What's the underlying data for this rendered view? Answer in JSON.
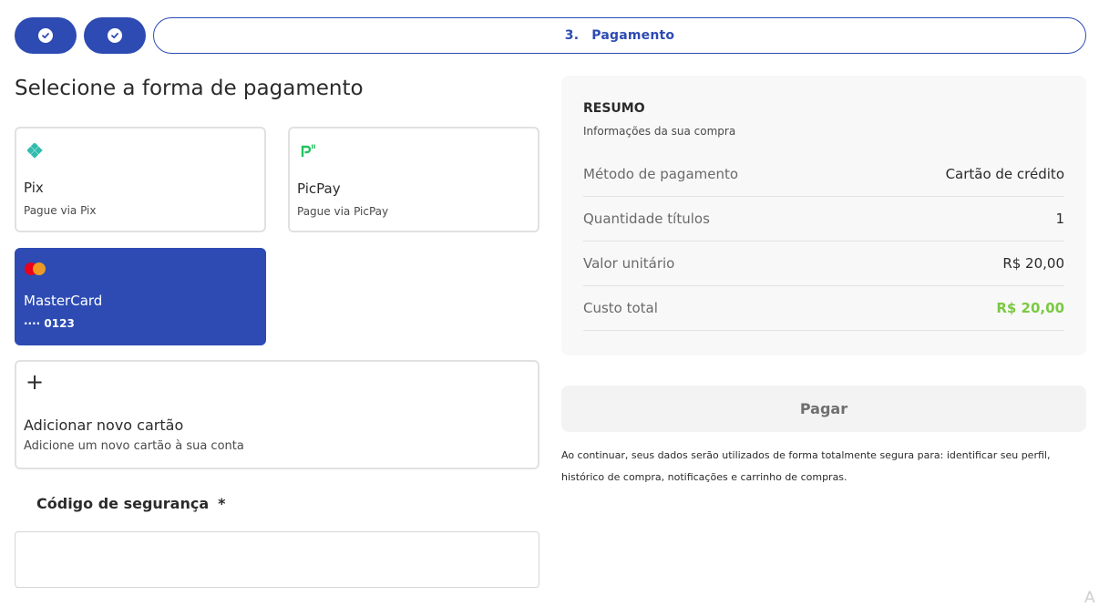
{
  "stepper": {
    "current_number": "3.",
    "current_label": "Pagamento"
  },
  "section_title": "Selecione a forma de pagamento",
  "methods": {
    "pix": {
      "title": "Pix",
      "subtitle": "Pague via Pix"
    },
    "picpay": {
      "title": "PicPay",
      "subtitle": "Pague via PicPay"
    },
    "mastercard": {
      "title": "MasterCard",
      "subtitle": "···· 0123"
    },
    "add_card": {
      "plus": "+",
      "title": "Adicionar novo cartão",
      "subtitle": "Adicione um novo cartão à sua conta"
    }
  },
  "security": {
    "label": "Código de segurança",
    "required": "*",
    "value": ""
  },
  "summary": {
    "heading": "RESUMO",
    "subheading": "Informações da sua compra",
    "rows": [
      {
        "key": "Método de pagamento",
        "value": "Cartão de crédito"
      },
      {
        "key": "Quantidade títulos",
        "value": "1"
      },
      {
        "key": "Valor unitário",
        "value": "R$ 20,00"
      },
      {
        "key": "Custo total",
        "value": "R$ 20,00"
      }
    ]
  },
  "pay_button": "Pagar",
  "disclaimer": "Ao continuar, seus dados serão utilizados de forma totalmente segura para: identificar seu perfil, histórico de compra, notificações e carrinho de compras.",
  "corner_text": "A",
  "colors": {
    "primary": "#2d4bb3",
    "total_green": "#7ac943",
    "pix_teal": "#32bcad",
    "picpay_green": "#21c25e"
  }
}
